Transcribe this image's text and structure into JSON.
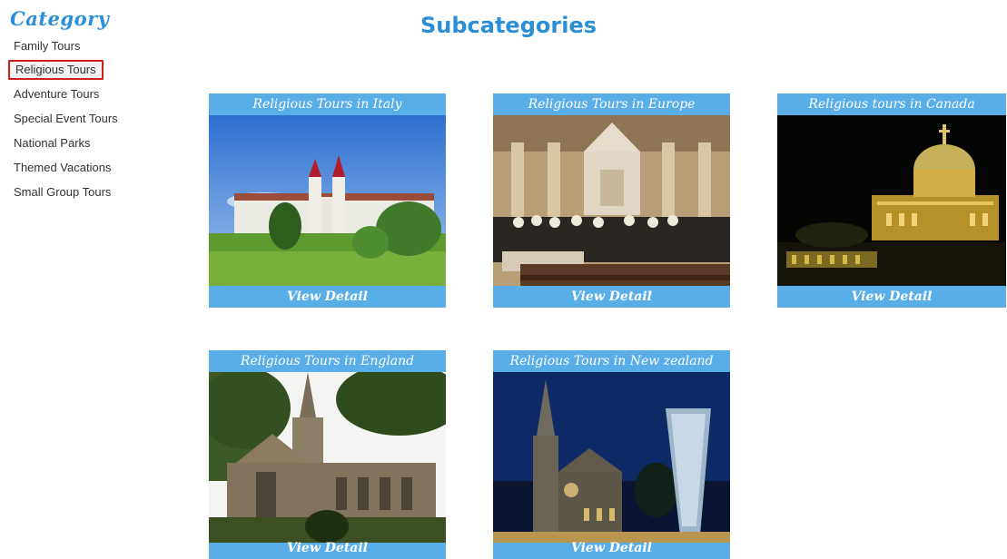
{
  "sidebar": {
    "title": "Category",
    "items": [
      {
        "label": "Family Tours"
      },
      {
        "label": "Religious Tours"
      },
      {
        "label": "Adventure Tours"
      },
      {
        "label": "Special Event Tours"
      },
      {
        "label": "National Parks"
      },
      {
        "label": "Themed Vacations"
      },
      {
        "label": "Small Group Tours"
      }
    ]
  },
  "main": {
    "title": "Subcategories",
    "cards": [
      {
        "title": "Religious Tours in Italy",
        "detail": "View Detail"
      },
      {
        "title": "Religious Tours in Europe",
        "detail": "View Detail"
      },
      {
        "title": "Religious tours in Canada",
        "detail": "View Detail"
      },
      {
        "title": "Religious Tours in England",
        "detail": "View Detail"
      },
      {
        "title": "Religious Tours in New zealand",
        "detail": "View Detail"
      }
    ]
  },
  "colors": {
    "accent": "#2b8fd8",
    "card_band": "#5aaee8",
    "active_border": "#cc1f1f"
  }
}
